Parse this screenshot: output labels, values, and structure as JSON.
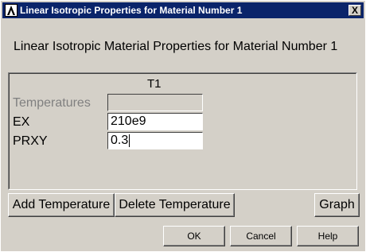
{
  "window": {
    "title": "Linear Isotropic Properties for Material Number 1",
    "close_glyph": "X",
    "app_icon": "ansys-logo-icon"
  },
  "heading": "Linear Isotropic Material Properties for Material Number 1",
  "table": {
    "column_header": "T1",
    "rows": [
      {
        "label": "Temperatures",
        "value": "",
        "enabled": false
      },
      {
        "label": "EX",
        "value": "210e9",
        "enabled": true
      },
      {
        "label": "PRXY",
        "value": "0.3",
        "enabled": true,
        "focused": true
      }
    ]
  },
  "buttons": {
    "add_temperature": "Add Temperature",
    "delete_temperature": "Delete Temperature",
    "graph": "Graph",
    "ok": "OK",
    "cancel": "Cancel",
    "help": "Help"
  },
  "colors": {
    "titlebar": "#0a246a",
    "window": "#d4d0c8",
    "disabled_text": "#808080"
  }
}
